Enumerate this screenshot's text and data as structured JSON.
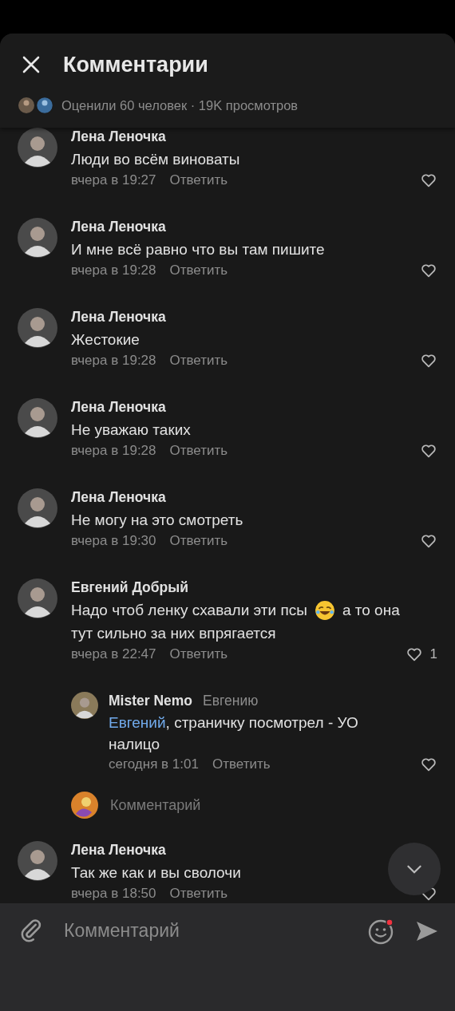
{
  "header": {
    "title": "Комментарии",
    "stats": "Оценили 60 человек · 19K просмотров"
  },
  "comments": [
    {
      "kind": "comment",
      "author": "Лена Леночка",
      "text": "Люди во всём виноваты",
      "time": "вчера в 19:27",
      "reply": "Ответить"
    },
    {
      "kind": "comment",
      "author": "Лена Леночка",
      "text": "И мне всё равно что вы там пишите",
      "time": "вчера в 19:28",
      "reply": "Ответить"
    },
    {
      "kind": "comment",
      "author": "Лена Леночка",
      "text": "Жестокие",
      "time": "вчера в 19:28",
      "reply": "Ответить"
    },
    {
      "kind": "comment",
      "author": "Лена Леночка",
      "text": "Не уважаю таких",
      "time": "вчера в 19:28",
      "reply": "Ответить"
    },
    {
      "kind": "comment",
      "author": "Лена Леночка",
      "text": "Не могу на это смотреть",
      "time": "вчера в 19:30",
      "reply": "Ответить"
    },
    {
      "kind": "comment",
      "author": "Евгений Добрый",
      "text": "Надо чтоб ленку схавали эти псы",
      "emoji": true,
      "text_after": "а то она",
      "text_line2": "тут сильно за них впрягается",
      "time": "вчера в 22:47",
      "reply": "Ответить",
      "likes": "1"
    },
    {
      "kind": "reply",
      "author": "Mister Nemo",
      "to": "Евгению",
      "mention": "Евгений",
      "text": ", страничку посмотрел - УО налицо",
      "time": "сегодня в 1:01",
      "reply": "Ответить"
    },
    {
      "kind": "reply_input",
      "placeholder": "Комментарий"
    },
    {
      "kind": "comment",
      "author": "Лена Леночка",
      "text": "Так же как и вы сволочи",
      "time": "вчера в 18:50",
      "reply": "Ответить"
    }
  ],
  "composer": {
    "placeholder": "Комментарий",
    "emoji_badge": true
  }
}
